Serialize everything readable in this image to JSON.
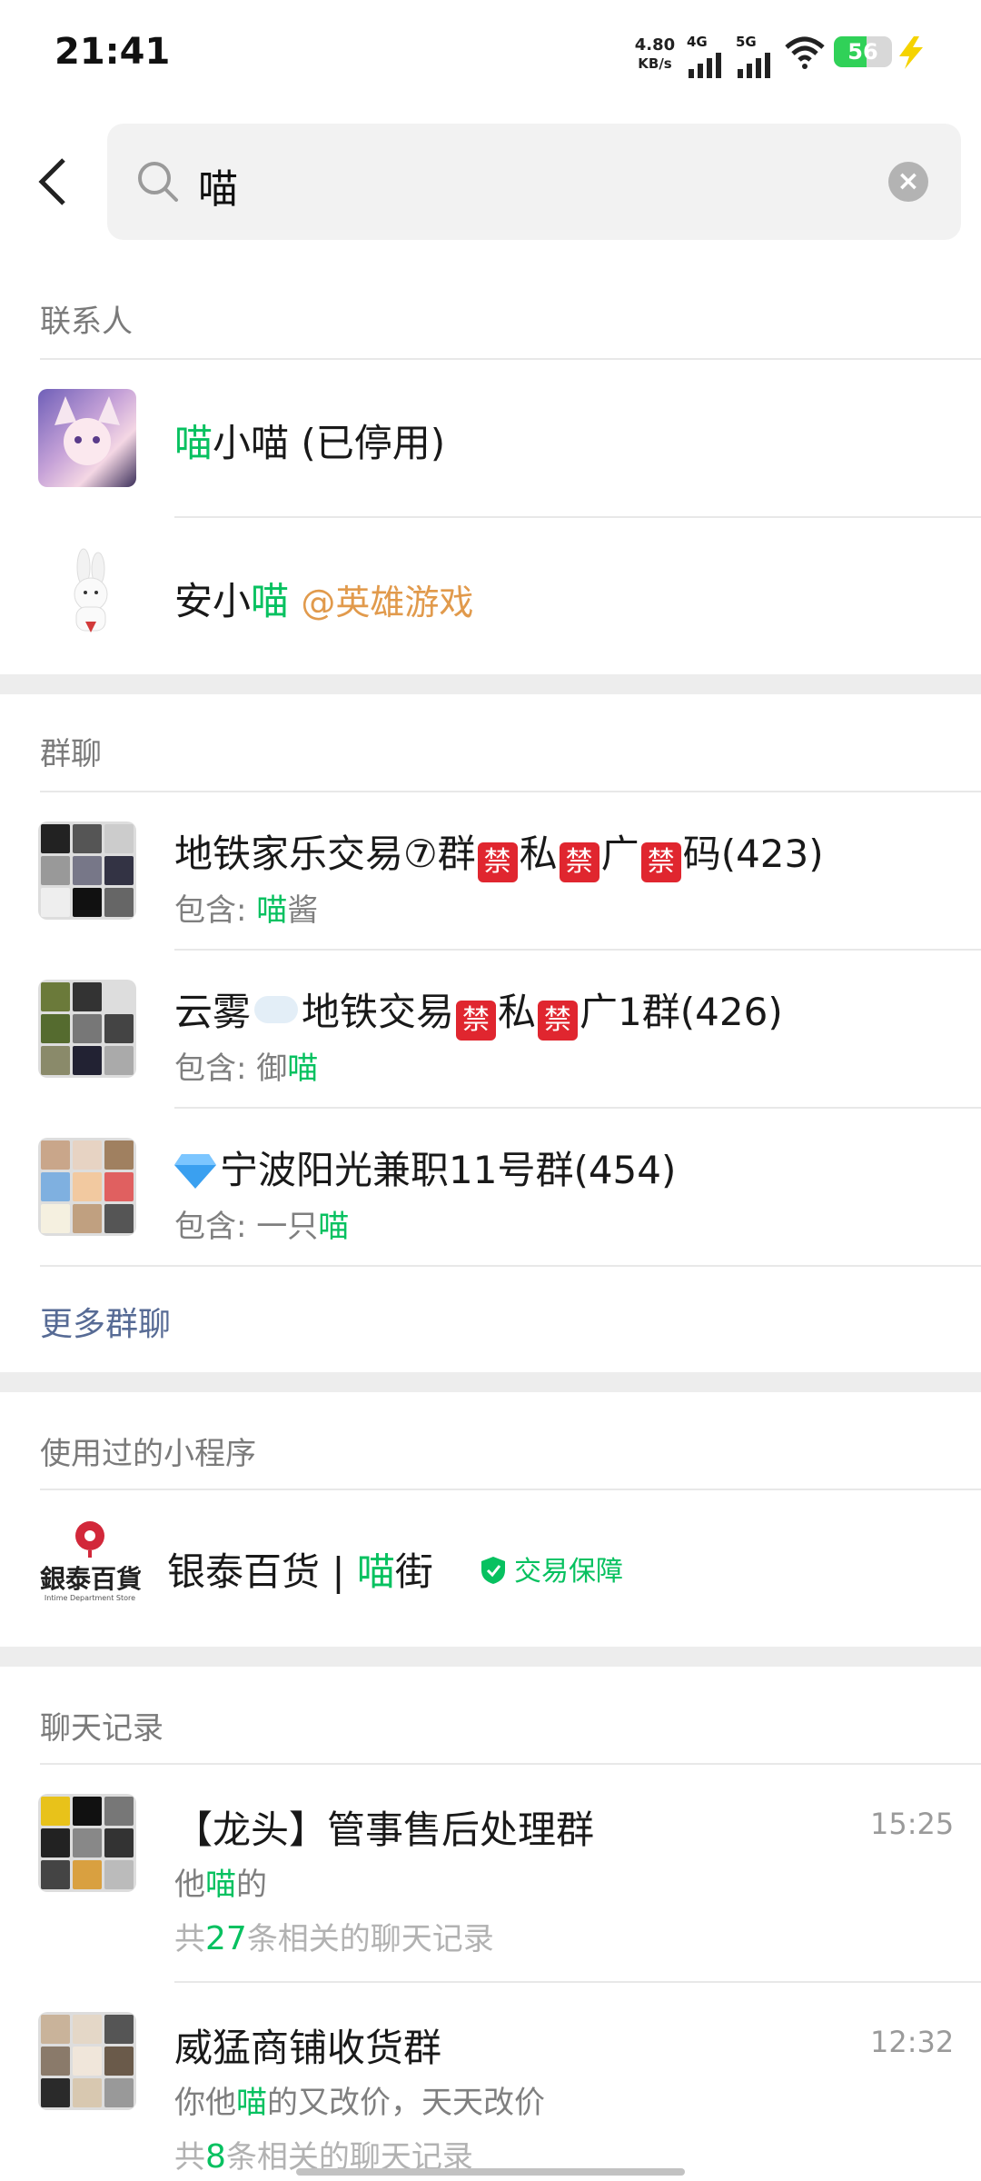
{
  "status_bar": {
    "time": "21:41",
    "net_speed_value": "4.80",
    "net_speed_unit": "KB/s",
    "signal_4g": "4G",
    "signal_5g": "5G",
    "battery": "56"
  },
  "search": {
    "query": "喵"
  },
  "contacts": {
    "title": "联系人",
    "items": [
      {
        "hl": "喵",
        "rest": "小喵 (已停用)"
      },
      {
        "pre": "安小",
        "hl": "喵",
        "tag": "@英雄游戏"
      }
    ]
  },
  "groups": {
    "title": "群聊",
    "items": [
      {
        "parts": [
          "地铁家乐交易⑦群",
          "私",
          "广",
          "码(423)"
        ],
        "ban": "禁",
        "sub_prefix": "包含: ",
        "sub_hl": "喵",
        "sub_rest": "酱"
      },
      {
        "parts": [
          "云雾",
          "地铁交易",
          "私",
          "广1群(426)"
        ],
        "ban": "禁",
        "sub_prefix": "包含: 御",
        "sub_hl": "喵",
        "sub_rest": ""
      },
      {
        "name": "宁波阳光兼职11号群(454)",
        "sub_prefix": "包含: 一只",
        "sub_hl": "喵",
        "sub_rest": ""
      }
    ],
    "more": "更多群聊"
  },
  "mini_programs": {
    "title": "使用过的小程序",
    "logo_text": "銀泰百貨",
    "logo_sub": "Intime Department Store",
    "name_pre": "银泰百货 | ",
    "name_hl": "喵",
    "name_rest": "街",
    "badge": "交易保障"
  },
  "chat_records": {
    "title": "聊天记录",
    "items": [
      {
        "name": "【龙头】管事售后处理群",
        "time": "15:25",
        "msg_pre": "他",
        "msg_hl": "喵",
        "msg_rest": "的",
        "count_pre": "共",
        "count": "27",
        "count_rest": "条相关的聊天记录"
      },
      {
        "name": "威猛商铺收货群",
        "time": "12:32",
        "msg_pre": "你他",
        "msg_hl": "喵",
        "msg_rest": "的又改价，天天改价",
        "count_pre": "共",
        "count": "8",
        "count_rest": "条相关的聊天记录"
      }
    ]
  },
  "colors": {
    "highlight": "#07c160",
    "link": "#576b95",
    "tag": "#e19a4c",
    "ban": "#e0262f"
  }
}
